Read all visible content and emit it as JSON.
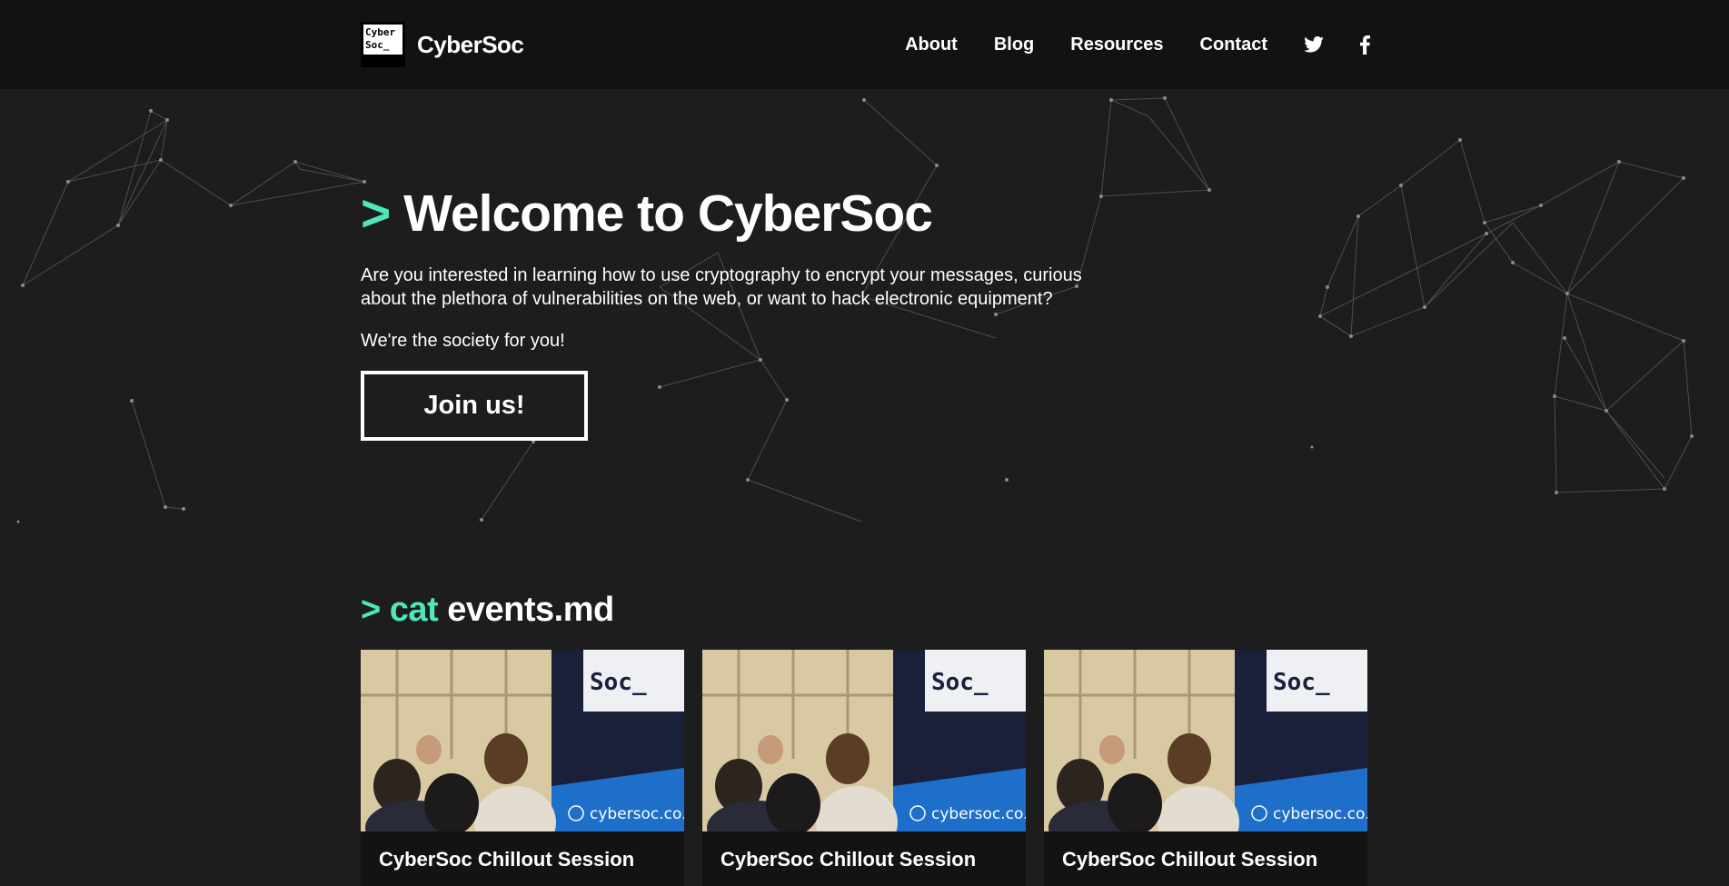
{
  "nav": {
    "logo_text": "Cyber\nSoc_",
    "brand": "CyberSoc",
    "links": [
      {
        "label": "About"
      },
      {
        "label": "Blog"
      },
      {
        "label": "Resources"
      },
      {
        "label": "Contact"
      }
    ],
    "icons": [
      "twitter-icon",
      "facebook-icon"
    ]
  },
  "hero": {
    "prompt": ">",
    "title": "Welcome to CyberSoc",
    "description": "Are you interested in learning how to use cryptography to encrypt your messages, curious about the plethora of vulnerabilities on the web, or want to hack electronic equipment?",
    "tagline": "We're the society for you!",
    "cta": "Join us!"
  },
  "events": {
    "prompt": ">",
    "command": "cat",
    "file": "events.md",
    "cards": [
      {
        "title": "CyberSoc Chillout Session",
        "banner_text": "cybersoc.co.uk",
        "sign_text": "Cyber\nSoc_"
      },
      {
        "title": "CyberSoc Chillout Session",
        "banner_text": "cybersoc.co.uk",
        "sign_text": "Cyber\nSoc_"
      },
      {
        "title": "CyberSoc Chillout Session",
        "banner_text": "cybersoc.co.uk",
        "sign_text": "Cyber\nSoc_"
      }
    ]
  },
  "colors": {
    "accent": "#4ee8bd",
    "background": "#1d1d1d",
    "navbar": "#121212",
    "text": "#ffffff"
  }
}
